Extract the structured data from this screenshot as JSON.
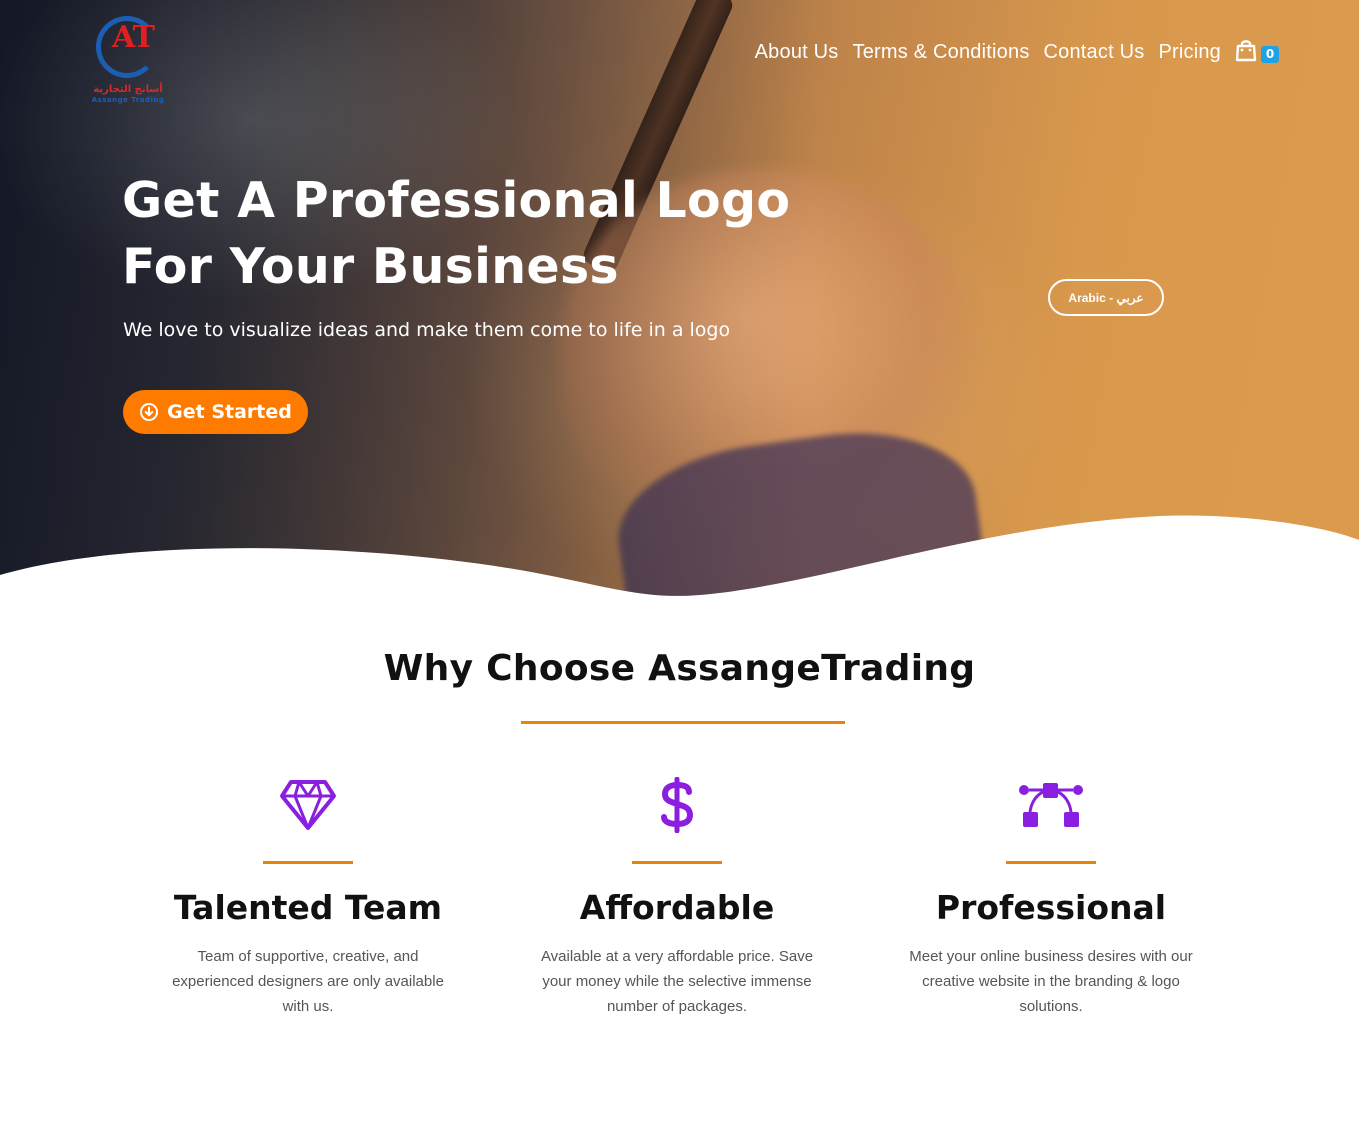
{
  "logo": {
    "mark": "AT",
    "arabic_text": "أسانج التجارية",
    "english_text": "Assange Trading"
  },
  "nav": {
    "items": [
      {
        "label": "About Us"
      },
      {
        "label": "Terms & Conditions"
      },
      {
        "label": "Contact Us"
      },
      {
        "label": "Pricing"
      }
    ],
    "cart_icon": "shopping-bag-icon",
    "cart_count": "0"
  },
  "hero": {
    "title_line1": "Get A Professional Logo",
    "title_line2": "For Your Business",
    "subtitle": "We love to visualize ideas and make them come to life in a logo",
    "cta_label": "Get Started",
    "cta_icon": "arrow-down-circle-icon",
    "language_button": "Arabic - عربي"
  },
  "why": {
    "title": "Why Choose AssangeTrading",
    "features": [
      {
        "icon": "diamond-icon",
        "title": "Talented Team",
        "text": "Team of supportive, creative, and experienced designers are only available with us."
      },
      {
        "icon": "dollar-icon",
        "title": "Affordable",
        "text": "Available at a very affordable price. Save your money while the selective immense number of packages."
      },
      {
        "icon": "vector-nodes-icon",
        "title": "Professional",
        "text": "Meet your online business desires with our creative website in the branding & logo solutions."
      }
    ]
  },
  "colors": {
    "accent_orange": "#ff7b00",
    "rule_orange": "#e8840a",
    "icon_purple": "#8a1fe0",
    "badge_blue": "#1fa2e6"
  }
}
